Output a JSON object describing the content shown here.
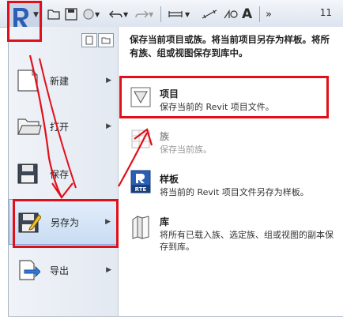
{
  "toolbar": {
    "right_number": "11",
    "text_tool_label": "A",
    "overflow": "»"
  },
  "menu": {
    "left_items": [
      {
        "label": "新建"
      },
      {
        "label": "打开"
      },
      {
        "label": "保存"
      },
      {
        "label": "另存为"
      },
      {
        "label": "导出"
      }
    ],
    "right": {
      "description": "保存当前项目或族。将当前项目另存为样板。将所有族、组或视图保存到库中。",
      "options": [
        {
          "title": "项目",
          "desc": "保存当前的 Revit 项目文件。"
        },
        {
          "title": "族",
          "desc": "保存当前族。"
        },
        {
          "title": "样板",
          "desc": "将当前的 Revit 项目文件另存为样板。"
        },
        {
          "title": "库",
          "desc": "将所有已载入族、选定族、组或视图的副本保存到库。"
        }
      ],
      "template_icon_text": "RTE"
    }
  },
  "colors": {
    "highlight": "#e0101a",
    "selected_bg": "#c9dcf3",
    "app_blue": "#2a5fb5"
  }
}
